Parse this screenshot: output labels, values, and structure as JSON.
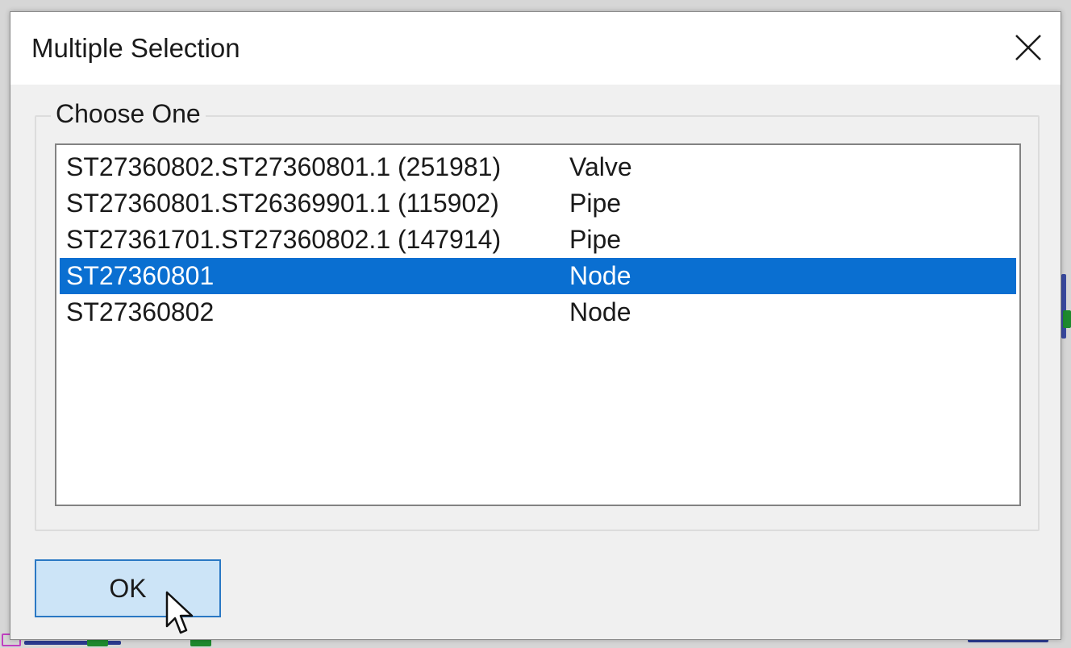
{
  "dialog": {
    "title": "Multiple Selection",
    "close_icon": "close-icon"
  },
  "group": {
    "label": "Choose One"
  },
  "list": {
    "selected_index": 3,
    "items": [
      {
        "name": "ST27360802.ST27360801.1 (251981)",
        "type": "Valve"
      },
      {
        "name": "ST27360801.ST26369901.1 (115902)",
        "type": "Pipe"
      },
      {
        "name": "ST27361701.ST27360802.1 (147914)",
        "type": "Pipe"
      },
      {
        "name": "ST27360801",
        "type": "Node"
      },
      {
        "name": "ST27360802",
        "type": "Node"
      }
    ]
  },
  "buttons": {
    "ok_label": "OK"
  },
  "colors": {
    "selection": "#0a6fd1",
    "button_face": "#cce4f7",
    "button_border": "#2a78c4"
  }
}
